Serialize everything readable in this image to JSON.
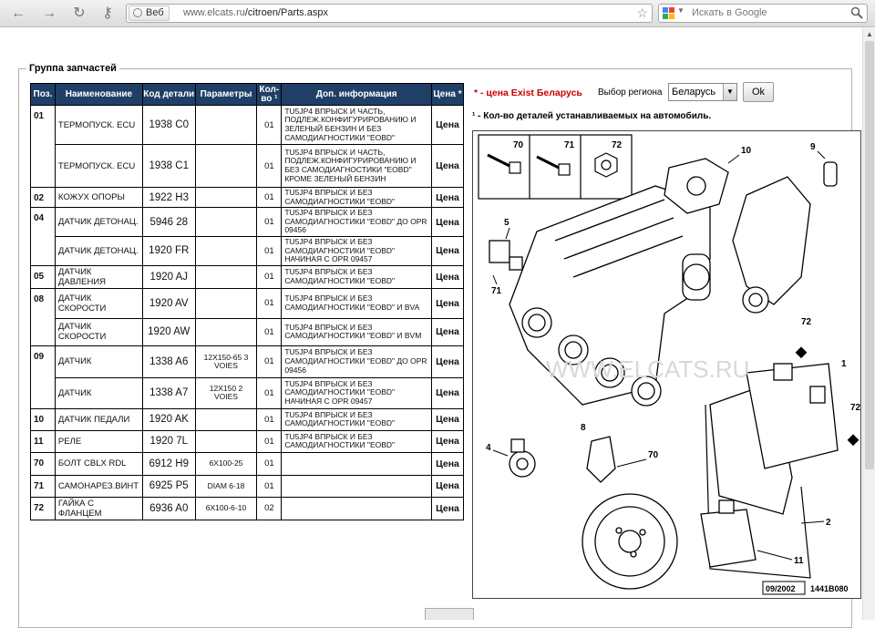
{
  "browser": {
    "back": "←",
    "forward": "→",
    "reload": "↻",
    "key": "⚷",
    "site_button": "Веб",
    "url_host": "www.elcats.ru",
    "url_path": "/citroen/Parts.aspx",
    "search_placeholder": "Искать в Google"
  },
  "group_title": "Группа запчастей",
  "table": {
    "headers": [
      "Поз.",
      "Наименование",
      "Код детали",
      "Параметры",
      "Кол-во ¹",
      "Доп. информация",
      "Цена *"
    ],
    "rows": [
      {
        "pos": "01",
        "name": "ТЕРМОПУСК. ECU",
        "code": "1938 C0",
        "params": "",
        "qty": "01",
        "info": "TU5JP4 ВПРЫСК И ЧАСТЬ, ПОДЛЕЖ.КОНФИГУРИРОВАНИЮ И ЗЕЛЕНЫЙ БЕНЗИН И БЕЗ САМОДИАГНОСТИКИ \"EOBD\"",
        "price": "Цена"
      },
      {
        "pos": "",
        "name": "ТЕРМОПУСК. ECU",
        "code": "1938 C1",
        "params": "",
        "qty": "01",
        "info": "TU5JP4 ВПРЫСК И ЧАСТЬ, ПОДЛЕЖ.КОНФИГУРИРОВАНИЮ И БЕЗ САМОДИАГНОСТИКИ \"EOBD\" КРОМЕ ЗЕЛЕНЫЙ БЕНЗИН",
        "price": "Цена"
      },
      {
        "pos": "02",
        "name": "КОЖУХ ОПОРЫ",
        "code": "1922 H3",
        "params": "",
        "qty": "01",
        "info": "TU5JP4 ВПРЫСК И БЕЗ САМОДИАГНОСТИКИ \"EOBD\"",
        "price": "Цена"
      },
      {
        "pos": "04",
        "name": "ДАТЧИК ДЕТОНАЦ.",
        "code": "5946 28",
        "params": "",
        "qty": "01",
        "info": "TU5JP4 ВПРЫСК И БЕЗ САМОДИАГНОСТИКИ \"EOBD\" ДО OPR 09456",
        "price": "Цена"
      },
      {
        "pos": "",
        "name": "ДАТЧИК ДЕТОНАЦ.",
        "code": "1920 FR",
        "params": "",
        "qty": "01",
        "info": "TU5JP4 ВПРЫСК И БЕЗ САМОДИАГНОСТИКИ \"EOBD\" НАЧИНАЯ С OPR 09457",
        "price": "Цена"
      },
      {
        "pos": "05",
        "name": "ДАТЧИК ДАВЛЕНИЯ",
        "code": "1920 AJ",
        "params": "",
        "qty": "01",
        "info": "TU5JP4 ВПРЫСК И БЕЗ САМОДИАГНОСТИКИ \"EOBD\"",
        "price": "Цена"
      },
      {
        "pos": "08",
        "name": "ДАТЧИК СКОРОСТИ",
        "code": "1920 AV",
        "params": "",
        "qty": "01",
        "info": "TU5JP4 ВПРЫСК И БЕЗ САМОДИАГНОСТИКИ \"EOBD\" И BVA",
        "price": "Цена"
      },
      {
        "pos": "",
        "name": "ДАТЧИК СКОРОСТИ",
        "code": "1920 AW",
        "params": "",
        "qty": "01",
        "info": "TU5JP4 ВПРЫСК И БЕЗ САМОДИАГНОСТИКИ \"EOBD\" И BVM",
        "price": "Цена"
      },
      {
        "pos": "09",
        "name": "ДАТЧИК",
        "code": "1338 A6",
        "params": "12X150-65 3 VOIES",
        "qty": "01",
        "info": "TU5JP4 ВПРЫСК И БЕЗ САМОДИАГНОСТИКИ \"EOBD\" ДО OPR 09456",
        "price": "Цена"
      },
      {
        "pos": "",
        "name": "ДАТЧИК",
        "code": "1338 A7",
        "params": "12X150 2 VOIES",
        "qty": "01",
        "info": "TU5JP4 ВПРЫСК И БЕЗ САМОДИАГНОСТИКИ \"EOBD\" НАЧИНАЯ С OPR 09457",
        "price": "Цена"
      },
      {
        "pos": "10",
        "name": "ДАТЧИК ПЕДАЛИ",
        "code": "1920 AK",
        "params": "",
        "qty": "01",
        "info": "TU5JP4 ВПРЫСК И БЕЗ САМОДИАГНОСТИКИ \"EOBD\"",
        "price": "Цена"
      },
      {
        "pos": "11",
        "name": "РЕЛЕ",
        "code": "1920 7L",
        "params": "",
        "qty": "01",
        "info": "TU5JP4 ВПРЫСК И БЕЗ САМОДИАГНОСТИКИ \"EOBD\"",
        "price": "Цена"
      },
      {
        "pos": "70",
        "name": "БОЛТ CBLX RDL",
        "code": "6912 H9",
        "params": "6X100-25",
        "qty": "01",
        "info": "",
        "price": "Цена"
      },
      {
        "pos": "71",
        "name": "САМОНАРЕЗ.ВИНТ",
        "code": "6925 P5",
        "params": "DIAM 6-18",
        "qty": "01",
        "info": "",
        "price": "Цена"
      },
      {
        "pos": "72",
        "name": "ГАЙКА С ФЛАНЦЕМ",
        "code": "6936 A0",
        "params": "6X100-6-10",
        "qty": "02",
        "info": "",
        "price": "Цена"
      }
    ]
  },
  "price_note": "* - цена Exist Беларусь",
  "region_label": "Выбор региона",
  "region_value": "Беларусь",
  "ok_label": "Ok",
  "qty_note": "¹ - Кол-во деталей устанавливаемых на автомобиль.",
  "diagram": {
    "labels": [
      "70",
      "71",
      "72",
      "10",
      "9",
      "5",
      "71",
      "72",
      "1",
      "72",
      "8",
      "70",
      "4",
      "2",
      "11"
    ],
    "watermark": "WWW.ELCATS.RU",
    "stamp_date": "09/2002",
    "stamp_code": "1441B080"
  }
}
